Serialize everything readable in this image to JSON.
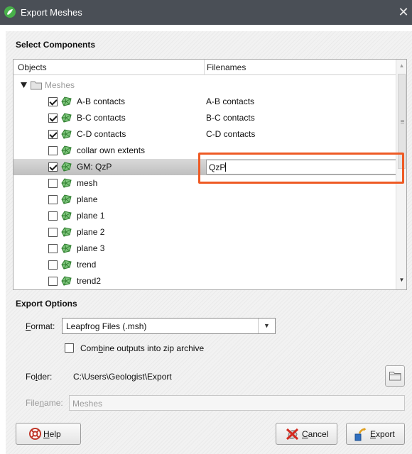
{
  "window": {
    "title": "Export Meshes",
    "close_glyph": "✕"
  },
  "select_components": {
    "heading": "Select Components",
    "columns": {
      "objects": "Objects",
      "filenames": "Filenames"
    },
    "folder_label": "Meshes",
    "rows": [
      {
        "label": "A-B contacts",
        "checked": true,
        "filename": "A-B contacts"
      },
      {
        "label": "B-C contacts",
        "checked": true,
        "filename": "B-C contacts"
      },
      {
        "label": "C-D contacts",
        "checked": true,
        "filename": "C-D contacts"
      },
      {
        "label": "collar own extents",
        "checked": false,
        "filename": ""
      },
      {
        "label": "GM: QzP",
        "checked": true,
        "filename": "QzP",
        "selected": true,
        "editing": true
      },
      {
        "label": "mesh",
        "checked": false,
        "filename": ""
      },
      {
        "label": "plane",
        "checked": false,
        "filename": ""
      },
      {
        "label": "plane 1",
        "checked": false,
        "filename": ""
      },
      {
        "label": "plane 2",
        "checked": false,
        "filename": ""
      },
      {
        "label": "plane 3",
        "checked": false,
        "filename": ""
      },
      {
        "label": "trend",
        "checked": false,
        "filename": ""
      },
      {
        "label": "trend2",
        "checked": false,
        "filename": ""
      }
    ]
  },
  "export_options": {
    "heading": "Export Options",
    "format": {
      "label_first": "F",
      "label_rest": "ormat:",
      "value": "Leapfrog Files (.msh)"
    },
    "zip": {
      "label_pre": "Com",
      "label_u": "b",
      "label_post": "ine outputs into zip archive",
      "checked": false
    },
    "folder": {
      "label_pre": "Fo",
      "label_u": "l",
      "label_post": "der:",
      "path": "C:\\Users\\Geologist\\Export"
    },
    "filename": {
      "label_pre": "File",
      "label_u": "n",
      "label_post": "ame:",
      "value": "Meshes"
    }
  },
  "buttons": {
    "help": {
      "u": "H",
      "rest": "elp"
    },
    "cancel": {
      "u": "C",
      "rest": "ancel"
    },
    "export": {
      "u": "E",
      "rest": "xport"
    }
  },
  "colors": {
    "titlebar": "#4a4f56",
    "highlight_border": "#ee5a24",
    "mesh_icon": "#4aa84a",
    "app_icon": "#48b04a"
  },
  "icons": [
    "app-icon",
    "close-icon",
    "folder-icon",
    "mesh-icon",
    "folder-browse-icon",
    "help-icon",
    "cancel-icon",
    "export-icon"
  ]
}
